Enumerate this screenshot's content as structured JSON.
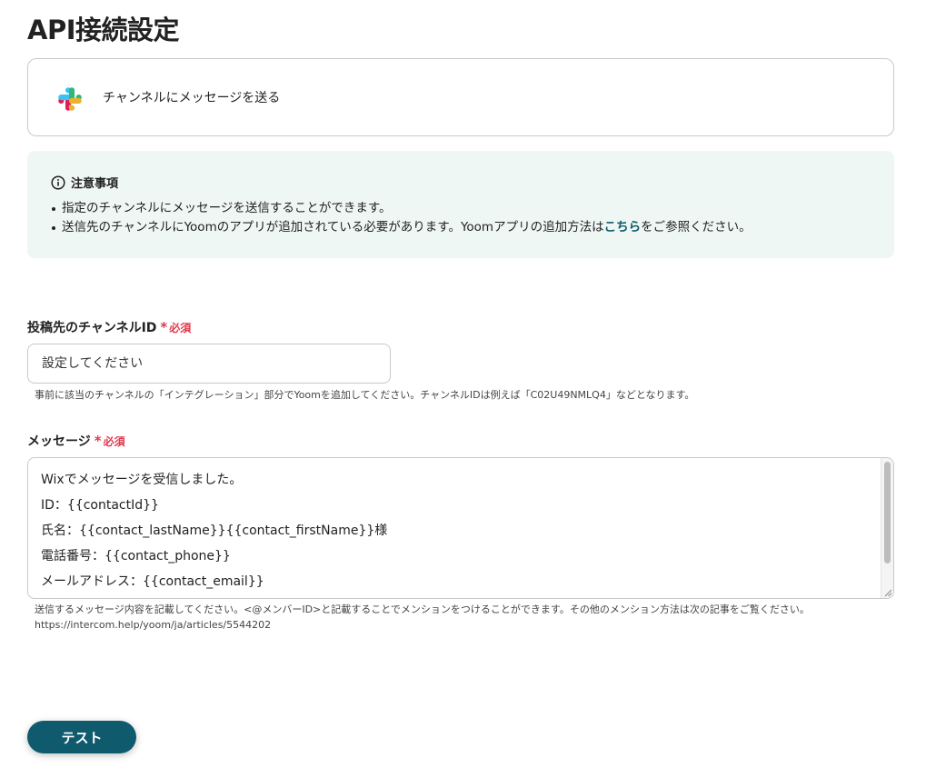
{
  "page": {
    "title": "API接続設定"
  },
  "app_card": {
    "icon": "slack-icon",
    "action_label": "チャンネルにメッセージを送る"
  },
  "notice": {
    "heading": "注意事項",
    "items": [
      {
        "text": "指定のチャンネルにメッセージを送信することができます。"
      },
      {
        "text_before": "送信先のチャンネルにYoomのアプリが追加されている必要があります。Yoomアプリの追加方法は",
        "link": "こちら",
        "text_after": "をご参照ください。"
      }
    ]
  },
  "channel_field": {
    "label": "投稿先のチャンネルID",
    "required": "必須",
    "placeholder": "設定してください",
    "help": "事前に該当のチャンネルの「インテグレーション」部分でYoomを追加してください。チャンネルIDは例えば「C02U49NMLQ4」などとなります。"
  },
  "message_field": {
    "label": "メッセージ",
    "required": "必須",
    "lines": [
      "Wixでメッセージを受信しました。",
      "ID：{{contactId}}",
      "氏名：{{contact_lastName}}{{contact_firstName}}様",
      "電話番号：{{contact_phone}}",
      "メールアドレス：{{contact_email}}"
    ],
    "help_line1": "送信するメッセージ内容を記載してください。<@メンバーID>と記載することでメンションをつけることができます。その他のメンション方法は次の記事をご覧ください。",
    "help_line2": "https://intercom.help/yoom/ja/articles/5544202"
  },
  "actions": {
    "test_label": "テスト"
  },
  "colors": {
    "primary": "#0f5a6d",
    "required": "#e0384b",
    "notice_bg": "#eff7f5",
    "link": "#0e5a6a"
  }
}
